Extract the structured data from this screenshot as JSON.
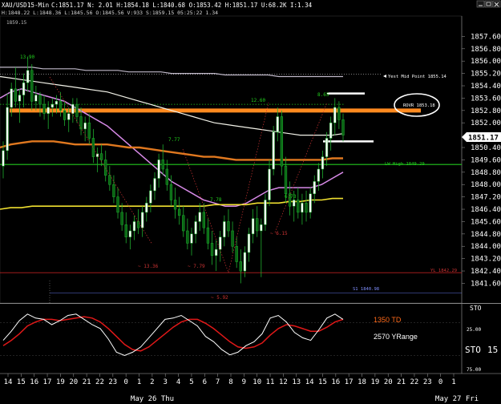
{
  "header": {
    "symbol": "XAU/USD",
    "interval": "15-Min",
    "line1": "C:1851.17  N: 2.01  H:1854.18  L:1840.68  O:1853.42  H:1851.17  U:68.2K  I:1.34",
    "line1_raw": "XAU/USD 15-Min C:1851.17 N: 2.01 H:1854.18 L:1840.68 O:1853.42 H:1851.17 U:68.2K I:1.34",
    "line2": "H:1848.22 L:1848.36 L:1845.56 O:1845.56 V:933 S:1859.15 05:25:22 1.34",
    "topleft_price": "1859.15",
    "window_controls": [
      "minimize",
      "restore",
      "close"
    ]
  },
  "price_axis": {
    "labels": [
      "1857.60",
      "1856.80",
      "1856.00",
      "1855.20",
      "1854.40",
      "1853.60",
      "1852.80",
      "1852.00",
      "1851.17",
      "1850.40",
      "1849.60",
      "1848.80",
      "1848.00",
      "1847.20",
      "1846.40",
      "1845.60",
      "1844.80",
      "1844.00",
      "1843.20",
      "1842.40",
      "1841.60"
    ],
    "current_price": "1851.17",
    "min": 1841.0,
    "max": 1858.4
  },
  "time_axis": {
    "labels": [
      "14",
      "15",
      "16",
      "17",
      "19",
      "20",
      "21",
      "22",
      "23",
      "0",
      "1",
      "2",
      "3",
      "4",
      "5",
      "6",
      "7",
      "8",
      "9",
      "10",
      "11",
      "12",
      "13",
      "14",
      "15",
      "16",
      "17",
      "18",
      "19",
      "20",
      "21",
      "22",
      "23",
      "0",
      "1"
    ],
    "date_labels": [
      "May 26 Thu",
      "May 27 Fri"
    ]
  },
  "annotations": {
    "yest_mid": "Yest Mid Point 1855.14",
    "rovr": "ROVR 1853.18",
    "lw_high": "LW High 1849.29",
    "yl": "YL 1842.29",
    "s1": "S1 1840.98",
    "high_1": "13.90",
    "high_2": "12.60",
    "high_3": "8.65",
    "mid_1": "7.77",
    "mid_2": "7.78",
    "mid_3": "6.73",
    "low_1": "~ 13.36",
    "low_2": "~ 7.79",
    "low_3": "~ 5.92",
    "low_4": "~ 6.15"
  },
  "indicator": {
    "label1": "1350 TD",
    "label2": "2570 YRange",
    "sto_label": "STO",
    "sto_value": "15",
    "levels": [
      "25.00",
      "75.00"
    ],
    "top_label": "STO"
  },
  "colors": {
    "candle": "#1fae2f",
    "candle_dark": "#0a6614",
    "orange_line": "#ff8a1f",
    "sma_white": "#f2f2e8",
    "sma_gray": "#bfb8c8",
    "sma_pink": "#d88ae8",
    "sma_orange": "#e0781f",
    "sma_yellow": "#f0e030",
    "green_level": "#22c81e",
    "stoch_white": "#ffffff",
    "stoch_red": "#e01818",
    "axis_text": "#ffffff"
  },
  "chart_data": {
    "type": "candlestick",
    "title": "XAU/USD 15-Min",
    "xlabel": "",
    "ylabel": "",
    "ylim": [
      1841.0,
      1858.4
    ],
    "candles": [
      {
        "o": 1849.2,
        "h": 1850.8,
        "l": 1848.4,
        "c": 1850.2
      },
      {
        "o": 1850.2,
        "h": 1853.9,
        "l": 1849.6,
        "c": 1853.0
      },
      {
        "o": 1853.0,
        "h": 1854.6,
        "l": 1852.4,
        "c": 1854.2
      },
      {
        "o": 1854.2,
        "h": 1855.6,
        "l": 1853.0,
        "c": 1853.4
      },
      {
        "o": 1853.4,
        "h": 1854.2,
        "l": 1852.0,
        "c": 1853.8
      },
      {
        "o": 1853.8,
        "h": 1855.2,
        "l": 1853.0,
        "c": 1854.6
      },
      {
        "o": 1854.6,
        "h": 1856.3,
        "l": 1854.0,
        "c": 1855.4
      },
      {
        "o": 1855.4,
        "h": 1855.8,
        "l": 1852.8,
        "c": 1853.4
      },
      {
        "o": 1853.4,
        "h": 1854.4,
        "l": 1852.8,
        "c": 1853.8
      },
      {
        "o": 1853.8,
        "h": 1854.0,
        "l": 1852.4,
        "c": 1853.2
      },
      {
        "o": 1853.2,
        "h": 1853.8,
        "l": 1852.2,
        "c": 1852.6
      },
      {
        "o": 1852.6,
        "h": 1853.4,
        "l": 1851.6,
        "c": 1853.0
      },
      {
        "o": 1853.0,
        "h": 1853.6,
        "l": 1852.4,
        "c": 1853.2
      },
      {
        "o": 1853.2,
        "h": 1853.8,
        "l": 1852.6,
        "c": 1853.4
      },
      {
        "o": 1853.4,
        "h": 1854.0,
        "l": 1852.4,
        "c": 1852.8
      },
      {
        "o": 1852.8,
        "h": 1853.4,
        "l": 1851.8,
        "c": 1852.2
      },
      {
        "o": 1852.2,
        "h": 1853.0,
        "l": 1851.4,
        "c": 1852.6
      },
      {
        "o": 1852.6,
        "h": 1853.6,
        "l": 1852.0,
        "c": 1853.2
      },
      {
        "o": 1853.2,
        "h": 1853.6,
        "l": 1852.0,
        "c": 1852.4
      },
      {
        "o": 1852.4,
        "h": 1853.0,
        "l": 1851.2,
        "c": 1851.6
      },
      {
        "o": 1851.6,
        "h": 1852.4,
        "l": 1850.8,
        "c": 1852.0
      },
      {
        "o": 1852.0,
        "h": 1852.6,
        "l": 1850.6,
        "c": 1851.0
      },
      {
        "o": 1851.0,
        "h": 1851.6,
        "l": 1849.4,
        "c": 1849.8
      },
      {
        "o": 1849.8,
        "h": 1850.4,
        "l": 1848.8,
        "c": 1850.0
      },
      {
        "o": 1850.0,
        "h": 1850.6,
        "l": 1849.2,
        "c": 1849.6
      },
      {
        "o": 1849.6,
        "h": 1850.2,
        "l": 1848.2,
        "c": 1848.6
      },
      {
        "o": 1848.6,
        "h": 1849.2,
        "l": 1847.6,
        "c": 1848.0
      },
      {
        "o": 1848.0,
        "h": 1848.6,
        "l": 1846.8,
        "c": 1847.2
      },
      {
        "o": 1847.2,
        "h": 1847.8,
        "l": 1845.8,
        "c": 1846.2
      },
      {
        "o": 1846.2,
        "h": 1846.8,
        "l": 1845.0,
        "c": 1845.4
      },
      {
        "o": 1845.4,
        "h": 1846.2,
        "l": 1844.2,
        "c": 1844.6
      },
      {
        "o": 1844.6,
        "h": 1845.4,
        "l": 1843.8,
        "c": 1845.0
      },
      {
        "o": 1845.0,
        "h": 1846.0,
        "l": 1844.4,
        "c": 1845.6
      },
      {
        "o": 1845.6,
        "h": 1846.4,
        "l": 1844.8,
        "c": 1845.2
      },
      {
        "o": 1845.2,
        "h": 1846.6,
        "l": 1844.6,
        "c": 1846.2
      },
      {
        "o": 1846.2,
        "h": 1847.2,
        "l": 1845.6,
        "c": 1846.8
      },
      {
        "o": 1846.8,
        "h": 1848.0,
        "l": 1846.2,
        "c": 1847.6
      },
      {
        "o": 1847.6,
        "h": 1848.8,
        "l": 1847.0,
        "c": 1848.4
      },
      {
        "o": 1848.4,
        "h": 1850.0,
        "l": 1847.8,
        "c": 1849.6
      },
      {
        "o": 1849.6,
        "h": 1850.6,
        "l": 1848.6,
        "c": 1849.0
      },
      {
        "o": 1849.0,
        "h": 1849.6,
        "l": 1847.6,
        "c": 1848.0
      },
      {
        "o": 1848.0,
        "h": 1848.6,
        "l": 1846.6,
        "c": 1847.0
      },
      {
        "o": 1847.0,
        "h": 1847.8,
        "l": 1845.8,
        "c": 1846.4
      },
      {
        "o": 1846.4,
        "h": 1847.2,
        "l": 1845.4,
        "c": 1846.0
      },
      {
        "o": 1846.0,
        "h": 1846.6,
        "l": 1844.6,
        "c": 1845.0
      },
      {
        "o": 1845.0,
        "h": 1845.8,
        "l": 1843.8,
        "c": 1844.2
      },
      {
        "o": 1844.2,
        "h": 1845.2,
        "l": 1843.4,
        "c": 1844.8
      },
      {
        "o": 1844.8,
        "h": 1846.0,
        "l": 1844.2,
        "c": 1845.6
      },
      {
        "o": 1845.6,
        "h": 1846.8,
        "l": 1845.0,
        "c": 1846.2
      },
      {
        "o": 1846.2,
        "h": 1846.8,
        "l": 1844.8,
        "c": 1845.2
      },
      {
        "o": 1845.2,
        "h": 1845.8,
        "l": 1843.8,
        "c": 1844.2
      },
      {
        "o": 1844.2,
        "h": 1845.0,
        "l": 1842.8,
        "c": 1843.4
      },
      {
        "o": 1843.4,
        "h": 1844.4,
        "l": 1842.4,
        "c": 1843.8
      },
      {
        "o": 1843.8,
        "h": 1845.0,
        "l": 1843.0,
        "c": 1844.6
      },
      {
        "o": 1844.6,
        "h": 1846.0,
        "l": 1844.0,
        "c": 1845.6
      },
      {
        "o": 1845.6,
        "h": 1846.4,
        "l": 1844.6,
        "c": 1845.0
      },
      {
        "o": 1845.0,
        "h": 1845.6,
        "l": 1843.6,
        "c": 1844.0
      },
      {
        "o": 1844.0,
        "h": 1844.6,
        "l": 1842.6,
        "c": 1843.0
      },
      {
        "o": 1843.0,
        "h": 1843.8,
        "l": 1841.6,
        "c": 1842.4
      },
      {
        "o": 1842.4,
        "h": 1844.0,
        "l": 1842.0,
        "c": 1843.6
      },
      {
        "o": 1843.6,
        "h": 1845.2,
        "l": 1843.0,
        "c": 1844.8
      },
      {
        "o": 1844.8,
        "h": 1846.4,
        "l": 1844.2,
        "c": 1845.8
      },
      {
        "o": 1845.8,
        "h": 1846.6,
        "l": 1844.6,
        "c": 1845.0
      },
      {
        "o": 1845.0,
        "h": 1845.8,
        "l": 1842.0,
        "c": 1845.4
      },
      {
        "o": 1845.4,
        "h": 1847.4,
        "l": 1845.0,
        "c": 1847.0
      },
      {
        "o": 1847.0,
        "h": 1849.6,
        "l": 1846.6,
        "c": 1849.0
      },
      {
        "o": 1849.0,
        "h": 1851.8,
        "l": 1848.6,
        "c": 1851.4
      },
      {
        "o": 1851.4,
        "h": 1853.0,
        "l": 1850.8,
        "c": 1852.4
      },
      {
        "o": 1852.4,
        "h": 1852.8,
        "l": 1848.6,
        "c": 1849.2
      },
      {
        "o": 1849.2,
        "h": 1849.8,
        "l": 1846.8,
        "c": 1847.4
      },
      {
        "o": 1847.4,
        "h": 1848.2,
        "l": 1846.0,
        "c": 1846.6
      },
      {
        "o": 1846.6,
        "h": 1847.6,
        "l": 1845.6,
        "c": 1847.0
      },
      {
        "o": 1847.0,
        "h": 1847.8,
        "l": 1845.8,
        "c": 1846.2
      },
      {
        "o": 1846.2,
        "h": 1847.4,
        "l": 1845.4,
        "c": 1846.8
      },
      {
        "o": 1846.8,
        "h": 1847.6,
        "l": 1845.6,
        "c": 1846.2
      },
      {
        "o": 1846.2,
        "h": 1847.8,
        "l": 1845.8,
        "c": 1847.4
      },
      {
        "o": 1847.4,
        "h": 1848.6,
        "l": 1846.8,
        "c": 1848.2
      },
      {
        "o": 1848.2,
        "h": 1849.4,
        "l": 1847.6,
        "c": 1849.0
      },
      {
        "o": 1849.0,
        "h": 1850.2,
        "l": 1848.4,
        "c": 1849.8
      },
      {
        "o": 1849.8,
        "h": 1851.4,
        "l": 1849.2,
        "c": 1851.0
      },
      {
        "o": 1851.0,
        "h": 1852.4,
        "l": 1850.2,
        "c": 1852.0
      },
      {
        "o": 1852.0,
        "h": 1853.6,
        "l": 1851.2,
        "c": 1853.0
      },
      {
        "o": 1853.0,
        "h": 1853.4,
        "l": 1851.6,
        "c": 1852.2
      },
      {
        "o": 1852.2,
        "h": 1852.6,
        "l": 1850.8,
        "c": 1851.2
      }
    ],
    "moving_averages": [
      {
        "name": "white",
        "values": [
          1855.0,
          1854.9,
          1854.8,
          1854.7,
          1854.6,
          1854.5,
          1854.4,
          1854.3,
          1854.2,
          1854.1,
          1854.0,
          1853.8,
          1853.6,
          1853.4,
          1853.2,
          1853.0,
          1852.8,
          1852.6,
          1852.4,
          1852.2,
          1852.0,
          1851.9,
          1851.8,
          1851.7,
          1851.6,
          1851.5,
          1851.4,
          1851.3,
          1851.2,
          1851.2,
          1851.2,
          1851.2,
          1851.3
        ]
      },
      {
        "name": "gray",
        "values": [
          1855.6,
          1855.6,
          1855.6,
          1855.6,
          1855.5,
          1855.5,
          1855.5,
          1855.5,
          1855.4,
          1855.4,
          1855.4,
          1855.4,
          1855.3,
          1855.3,
          1855.3,
          1855.3,
          1855.2,
          1855.2,
          1855.2,
          1855.2,
          1855.2,
          1855.1,
          1855.1,
          1855.1,
          1855.1,
          1855.1,
          1855.0,
          1855.0,
          1855.0,
          1855.0,
          1855.0,
          1855.0,
          1855.0
        ]
      },
      {
        "name": "pink",
        "values": [
          1853.6,
          1854.0,
          1854.2,
          1854.0,
          1853.8,
          1853.6,
          1853.4,
          1853.0,
          1852.6,
          1852.2,
          1851.8,
          1851.2,
          1850.6,
          1850.0,
          1849.4,
          1848.8,
          1848.2,
          1847.8,
          1847.4,
          1847.0,
          1846.8,
          1846.6,
          1846.6,
          1846.8,
          1847.2,
          1847.6,
          1847.8,
          1847.8,
          1847.8,
          1847.8,
          1848.0,
          1848.4,
          1848.8
        ]
      },
      {
        "name": "orange",
        "values": [
          1850.4,
          1850.6,
          1850.7,
          1850.8,
          1850.8,
          1850.8,
          1850.7,
          1850.6,
          1850.6,
          1850.6,
          1850.6,
          1850.5,
          1850.4,
          1850.4,
          1850.3,
          1850.2,
          1850.1,
          1850.0,
          1849.9,
          1849.8,
          1849.8,
          1849.7,
          1849.6,
          1849.6,
          1849.6,
          1849.6,
          1849.6,
          1849.6,
          1849.6,
          1849.6,
          1849.6,
          1849.7,
          1849.7
        ]
      },
      {
        "name": "yellow",
        "values": [
          1846.4,
          1846.5,
          1846.5,
          1846.6,
          1846.6,
          1846.6,
          1846.6,
          1846.6,
          1846.6,
          1846.6,
          1846.6,
          1846.6,
          1846.6,
          1846.6,
          1846.6,
          1846.6,
          1846.6,
          1846.6,
          1846.6,
          1846.6,
          1846.7,
          1846.7,
          1846.7,
          1846.7,
          1846.8,
          1846.8,
          1846.8,
          1846.9,
          1846.9,
          1847.0,
          1847.0,
          1847.1,
          1847.1
        ]
      }
    ],
    "levels": [
      {
        "name": "orange_thick",
        "value": 1852.8
      },
      {
        "name": "green",
        "value": 1849.3
      },
      {
        "name": "yest_mid",
        "value": 1855.14
      },
      {
        "name": "yl",
        "value": 1842.29
      },
      {
        "name": "s1",
        "value": 1840.98
      },
      {
        "name": "white_stub_1",
        "value": 1853.9
      },
      {
        "name": "white_stub_2",
        "value": 1850.8
      },
      {
        "name": "dotted_green",
        "value": 1853.2
      }
    ],
    "stochastic": {
      "white": [
        48,
        62,
        78,
        88,
        82,
        80,
        72,
        78,
        86,
        88,
        80,
        72,
        66,
        50,
        30,
        25,
        30,
        38,
        52,
        66,
        80,
        82,
        86,
        78,
        70,
        54,
        46,
        34,
        26,
        30,
        40,
        46,
        58,
        82,
        86,
        76,
        60,
        52,
        48,
        64,
        82,
        88,
        80
      ],
      "red": [
        40,
        48,
        58,
        70,
        76,
        80,
        80,
        78,
        80,
        82,
        84,
        82,
        76,
        66,
        54,
        42,
        34,
        32,
        38,
        48,
        58,
        68,
        76,
        80,
        80,
        74,
        66,
        56,
        46,
        38,
        36,
        38,
        44,
        56,
        66,
        72,
        70,
        66,
        62,
        62,
        68,
        76,
        80
      ]
    }
  }
}
